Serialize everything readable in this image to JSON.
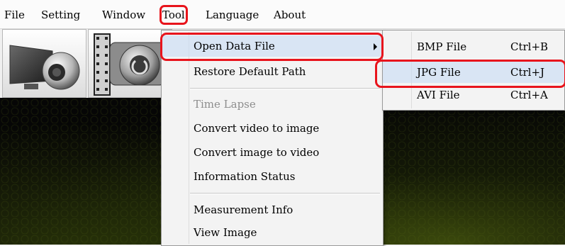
{
  "menubar": {
    "items": [
      {
        "label": "File"
      },
      {
        "label": "Setting"
      },
      {
        "label": "Window"
      },
      {
        "label": "Tool"
      },
      {
        "label": "Language"
      },
      {
        "label": "About"
      }
    ]
  },
  "toolbar": {
    "buttons": [
      {
        "icon": "monitor-webcam-icon"
      },
      {
        "icon": "camera-film-icon"
      }
    ]
  },
  "tool_menu": {
    "items": [
      {
        "label": "Open Data File",
        "submenu": true
      },
      {
        "label": "Restore Default Path"
      },
      {
        "label": "Time Lapse",
        "disabled": true
      },
      {
        "label": "Convert video to image"
      },
      {
        "label": "Convert image to video"
      },
      {
        "label": "Information Status"
      },
      {
        "label": "Measurement Info"
      },
      {
        "label": "View Image"
      }
    ]
  },
  "open_data_submenu": {
    "items": [
      {
        "label": "BMP File",
        "shortcut": "Ctrl+B"
      },
      {
        "label": "JPG File",
        "shortcut": "Ctrl+J"
      },
      {
        "label": "AVI File",
        "shortcut": "Ctrl+A"
      }
    ]
  },
  "colors": {
    "highlight_outline": "#e8141c",
    "menu_bg": "#f3f3f3",
    "disabled_text": "#8d8d8d"
  }
}
